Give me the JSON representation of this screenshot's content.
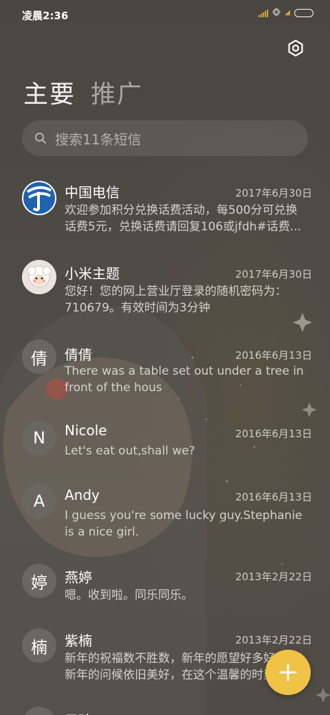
{
  "status_bar": {
    "time": "凌晨2:36"
  },
  "tabs": [
    {
      "label": "主要",
      "active": true
    },
    {
      "label": "推广",
      "active": false
    }
  ],
  "search": {
    "placeholder": "搜索11条短信"
  },
  "colors": {
    "fab": "#f0c246",
    "background": "#4e4b46",
    "avatar": "#6a6762"
  },
  "conversations": [
    {
      "name": "中国电信",
      "date": "2017年6月30日",
      "preview": "欢迎参加积分兑换话费活动，每500分可兑换话费5元，兑换话费请回复106或jfdh#话费...",
      "avatar_icon": "china-telecom-logo"
    },
    {
      "name": "小米主题",
      "date": "2017年6月30日",
      "preview": "您好！您的网上营业厅登录的随机密码为：710679。有效时间为3分钟",
      "avatar_icon": "sheep-mascot"
    },
    {
      "name": "倩倩",
      "date": "2016年6月13日",
      "preview": "There was a table set out under a tree in front of the hous",
      "avatar_text": "倩"
    },
    {
      "name": "Nicole",
      "date": "2016年6月13日",
      "preview": "Let's eat out,shall we?",
      "avatar_text": "N"
    },
    {
      "name": "Andy",
      "date": "2016年6月13日",
      "preview": "I guess you're some lucky guy.Stephanie is a nice girl.",
      "avatar_text": "A"
    },
    {
      "name": "燕婷",
      "date": "2013年2月22日",
      "preview": "嗯。收到啦。同乐同乐。",
      "avatar_text": "婷"
    },
    {
      "name": "紫楠",
      "date": "2013年2月22日",
      "preview": "新年的祝福数不胜数，新年的愿望好多好多，新年的问候依旧美好，在这个温馨的时刻",
      "avatar_text": "楠"
    },
    {
      "name": "子玲",
      "date": "",
      "preview": "",
      "avatar_text": "玲"
    }
  ]
}
